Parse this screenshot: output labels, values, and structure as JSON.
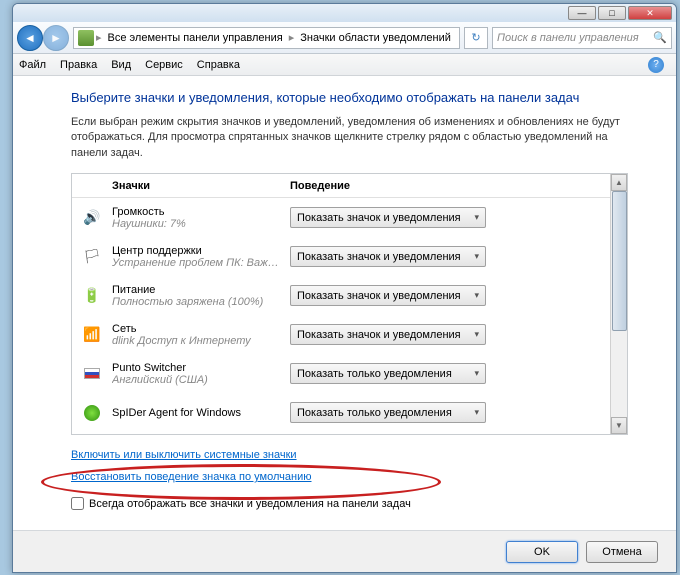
{
  "breadcrumb": {
    "item1": "Все элементы панели управления",
    "item2": "Значки области уведомлений"
  },
  "search": {
    "placeholder": "Поиск в панели управления"
  },
  "menu": {
    "file": "Файл",
    "edit": "Правка",
    "view": "Вид",
    "tools": "Сервис",
    "help": "Справка"
  },
  "page": {
    "heading": "Выберите значки и уведомления, которые необходимо отображать на панели задач",
    "desc": "Если выбран режим скрытия значков и уведомлений, уведомления об изменениях и обновлениях не будут отображаться. Для просмотра спрятанных значков щелкните стрелку рядом с областью уведомлений на панели задач."
  },
  "columns": {
    "icons": "Значки",
    "behavior": "Поведение"
  },
  "behaviors": {
    "show_all": "Показать значок и уведомления",
    "notif_only": "Показать только уведомления"
  },
  "rows": [
    {
      "title": "Громкость",
      "sub": "Наушники: 7%",
      "behavior": "show_all",
      "icon": "volume"
    },
    {
      "title": "Центр поддержки",
      "sub": "Устранение проблем ПК: Важных сооб...",
      "behavior": "show_all",
      "icon": "flag"
    },
    {
      "title": "Питание",
      "sub": "Полностью заряжена (100%)",
      "behavior": "show_all",
      "icon": "battery"
    },
    {
      "title": "Сеть",
      "sub": "dlink Доступ к Интернету",
      "behavior": "show_all",
      "icon": "network"
    },
    {
      "title": "Punto Switcher",
      "sub": "Английский (США)",
      "behavior": "notif_only",
      "icon": "ru-flag"
    },
    {
      "title": "SpIDer Agent for Windows",
      "sub": "",
      "behavior": "notif_only",
      "icon": "spider"
    }
  ],
  "links": {
    "system_icons": "Включить или выключить системные значки",
    "restore": "Восстановить поведение значка по умолчанию"
  },
  "checkbox": {
    "label": "Всегда отображать все значки и уведомления на панели задач"
  },
  "buttons": {
    "ok": "OK",
    "cancel": "Отмена"
  }
}
